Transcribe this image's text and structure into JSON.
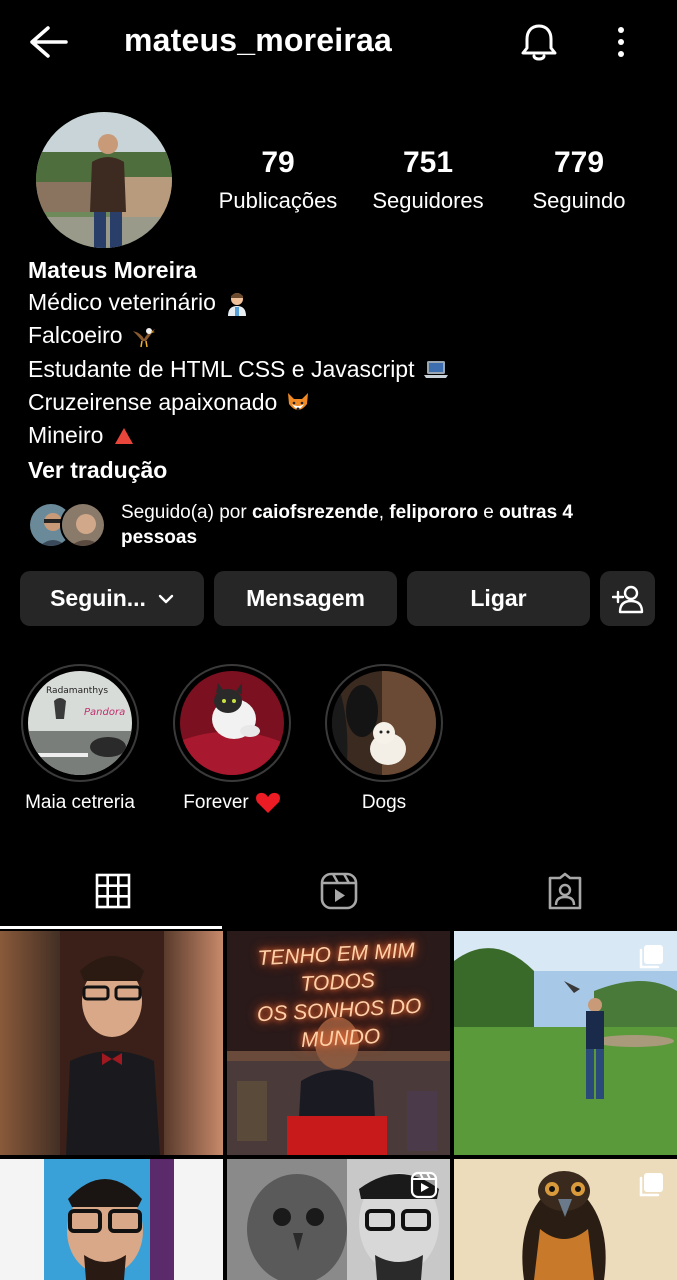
{
  "header": {
    "username": "mateus_moreiraa"
  },
  "stats": [
    {
      "value": "79",
      "label": "Publicações"
    },
    {
      "value": "751",
      "label": "Seguidores"
    },
    {
      "value": "779",
      "label": "Seguindo"
    }
  ],
  "bio": {
    "name": "Mateus Moreira",
    "lines": [
      {
        "text": "Médico veterinário",
        "emoji": "veterinarian-emoji"
      },
      {
        "text": "Falcoeiro",
        "emoji": "eagle-emoji"
      },
      {
        "text": "Estudante de HTML CSS e Javascript",
        "emoji": "laptop-emoji"
      },
      {
        "text": "Cruzeirense apaixonado",
        "emoji": "fox-emoji"
      },
      {
        "text": "Mineiro",
        "emoji": "red-triangle-emoji"
      }
    ],
    "translate": "Ver tradução"
  },
  "followed_by": {
    "prefix": "Seguido(a) por ",
    "user1": "caiofsrezende",
    "sep": ", ",
    "user2": "felipororo",
    "conj": " e ",
    "others": "outras 4 pessoas"
  },
  "actions": {
    "follow": "Seguin...",
    "message": "Mensagem",
    "call": "Ligar"
  },
  "highlights": [
    {
      "label": "Maia cetreria",
      "caption1": "Radamanthys",
      "caption2": "Pandora"
    },
    {
      "label": "Forever"
    },
    {
      "label": "Dogs"
    }
  ],
  "grid_texts": {
    "neon_line1": "TENHO EM MIM TODOS",
    "neon_line2": "OS SONHOS DO MUNDO"
  },
  "colors": {
    "background": "#000000",
    "button": "#262626",
    "heart": "#ed1c24",
    "neon": "#ff7a3a"
  }
}
